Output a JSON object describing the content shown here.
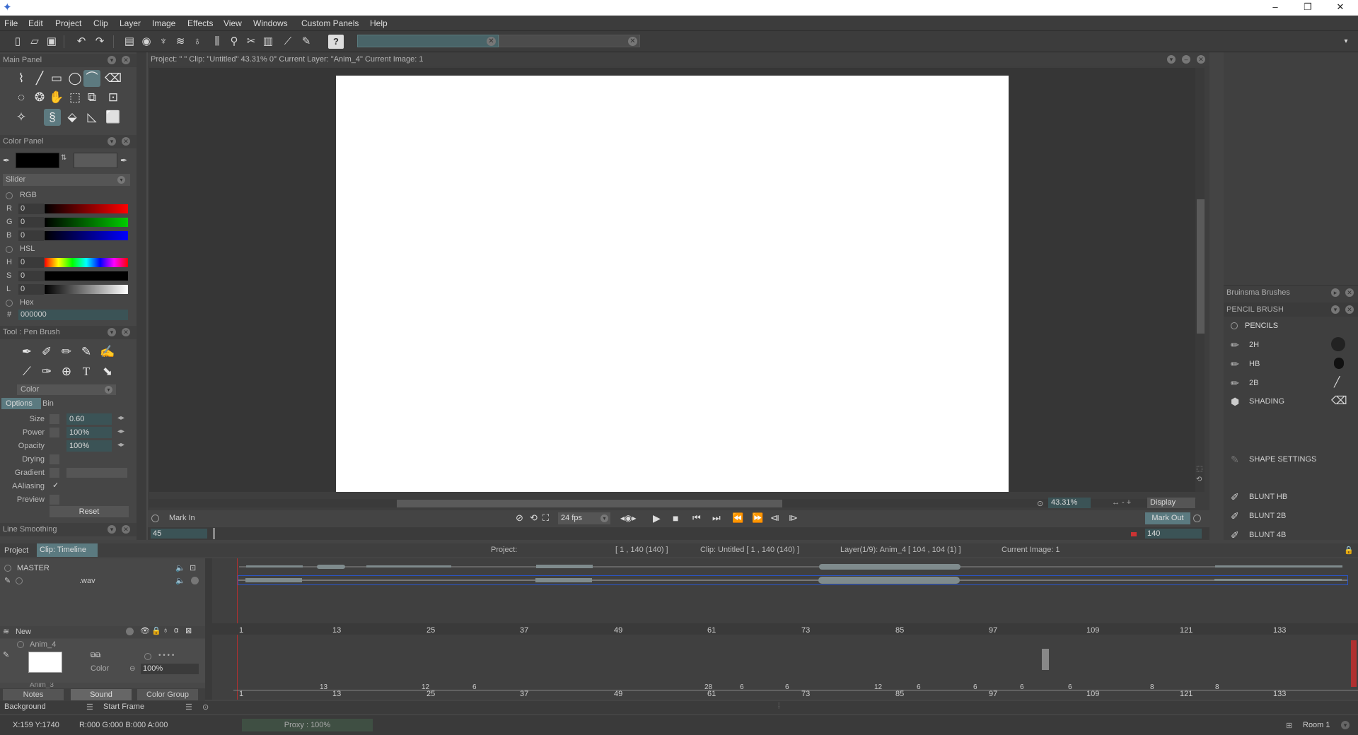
{
  "window": {
    "minimize": "–",
    "restore": "❐",
    "close": "✕"
  },
  "menu": [
    "File",
    "Edit",
    "Project",
    "Clip",
    "Layer",
    "Image",
    "Effects",
    "View",
    "Windows",
    "Custom Panels",
    "Help"
  ],
  "main_panel": {
    "title": "Main Panel"
  },
  "view_header": {
    "text": "Project: \"                        \" Clip: \"Untitled\"   43.31%   0°  Current Layer: \"Anim_4\"  Current Image: 1"
  },
  "color_panel": {
    "title": "Color Panel",
    "slider_title": "Slider",
    "rgb_label": "RGB",
    "hsl_label": "HSL",
    "hex_label": "Hex",
    "rows": [
      {
        "label": "R",
        "value": "0"
      },
      {
        "label": "G",
        "value": "0"
      },
      {
        "label": "B",
        "value": "0"
      },
      {
        "label": "H",
        "value": "0"
      },
      {
        "label": "S",
        "value": "0"
      },
      {
        "label": "L",
        "value": "0"
      }
    ],
    "hex_prefix": "#",
    "hex_value": "000000",
    "primary_color": "#000000"
  },
  "tool_panel": {
    "title": "Tool : Pen Brush",
    "color_select": "Color",
    "tabs": [
      "Options",
      "Bin"
    ],
    "options": [
      {
        "label": "Size",
        "value": "0.60"
      },
      {
        "label": "Power",
        "value": "100%"
      },
      {
        "label": "Opacity",
        "value": "100%"
      }
    ],
    "drying": "Drying",
    "gradient": "Gradient",
    "aliasing": "AAliasing",
    "preview": "Preview",
    "reset": "Reset"
  },
  "line_smoothing": {
    "title": "Line Smoothing",
    "value": "45"
  },
  "playback": {
    "mark_in": "Mark In",
    "fps": "24 fps",
    "mark_out": "Mark Out",
    "end_frame": "140",
    "zoom": "43.31%",
    "display": "Display"
  },
  "brushes": {
    "title": "Bruinsma Brushes",
    "sub": "PENCIL BRUSH",
    "group": "PENCILS",
    "items": [
      "2H",
      "HB",
      "2B",
      "SHADING"
    ],
    "shape_settings": "SHAPE SETTINGS",
    "blunt": [
      "BLUNT HB",
      "BLUNT 2B",
      "BLUNT 4B"
    ]
  },
  "timeline": {
    "tabs": [
      "Project",
      "Clip: Timeline"
    ],
    "info_project": "Project:",
    "info_range": "[ 1 , 140  (140) ]",
    "info_clip": "Clip: Untitled [ 1 , 140  (140) ]",
    "info_layer": "Layer(1/9): Anim_4 [ 104 , 104  (1) ]",
    "info_image": "Current Image: 1",
    "master": "MASTER",
    "wav": ".wav",
    "new": "New",
    "layer": "Anim_4",
    "layer2": "Anim_3",
    "color": "Color",
    "opacity": "100%",
    "ruler": [
      "1",
      "13",
      "25",
      "37",
      "49",
      "61",
      "73",
      "85",
      "97",
      "109",
      "121",
      "133"
    ],
    "bottom_tabs": [
      "Notes",
      "Sound",
      "Color Group"
    ],
    "background": "Background",
    "start_frame": "Start Frame",
    "hold_marks": [
      "13",
      "12",
      "6",
      "28",
      "6",
      "6",
      "12",
      "6",
      "6",
      "6",
      "6",
      "8",
      "8"
    ]
  },
  "status": {
    "coords": "X:159  Y:1740",
    "rgba": "R:000 G:000 B:000 A:000",
    "proxy": "Proxy : 100%",
    "room": "Room 1"
  }
}
